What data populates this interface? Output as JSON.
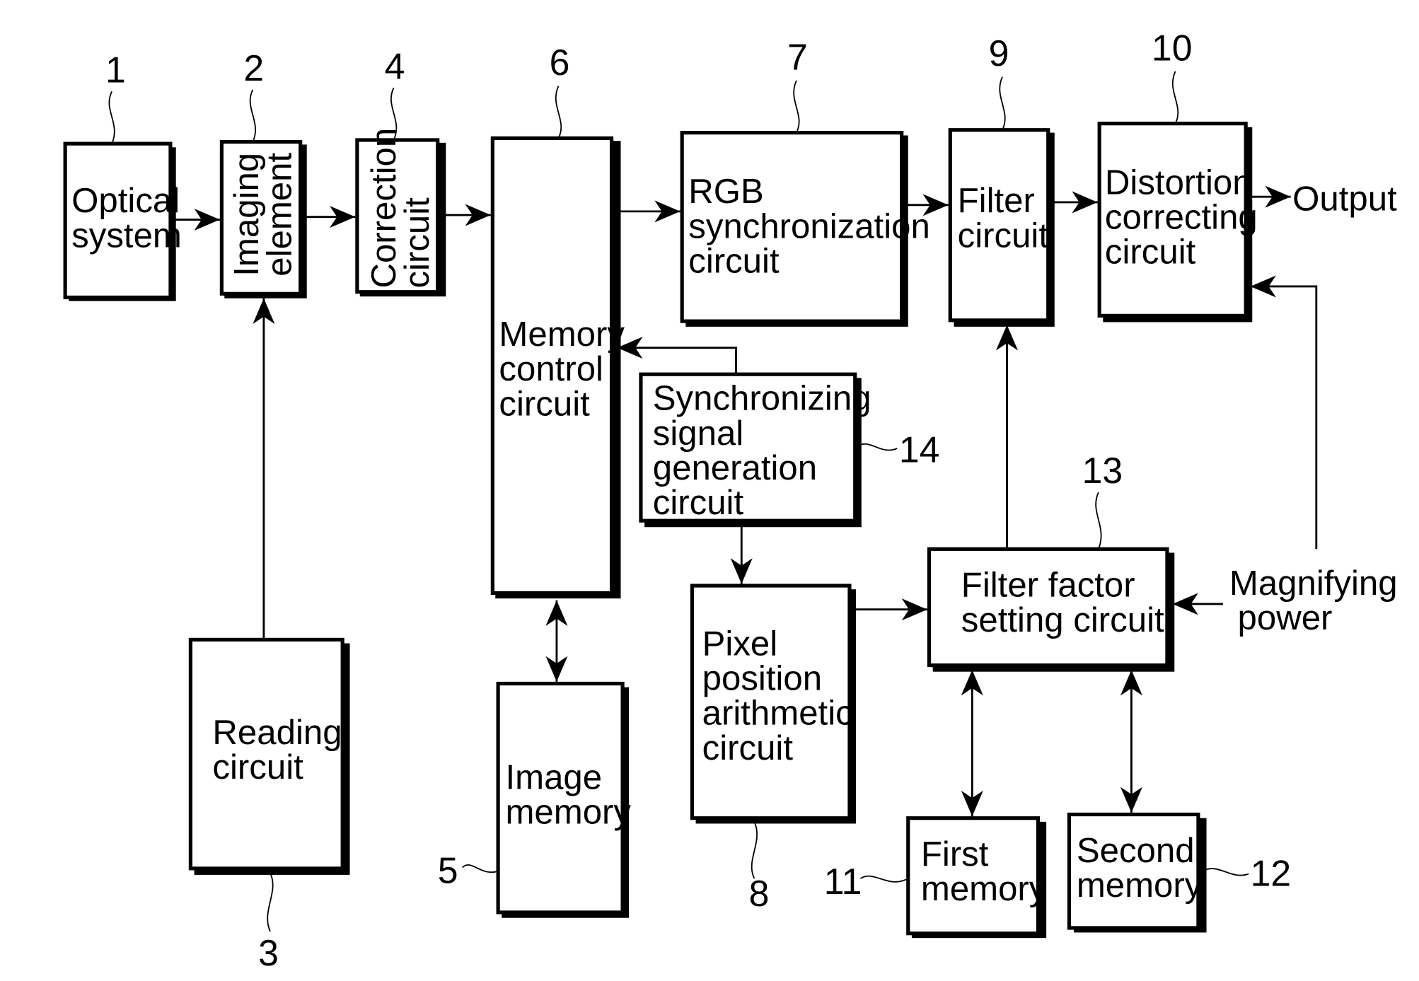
{
  "figure": {
    "blocks": [
      {
        "id": "optical-system",
        "ref": "1",
        "lines": [
          "Optical",
          "system"
        ]
      },
      {
        "id": "imaging-element",
        "ref": "2",
        "lines": [
          "Imaging",
          "element"
        ]
      },
      {
        "id": "reading-circuit",
        "ref": "3",
        "lines": [
          "Reading",
          "circuit"
        ]
      },
      {
        "id": "correction-circuit",
        "ref": "4",
        "lines": [
          "Correction",
          "circuit"
        ]
      },
      {
        "id": "image-memory",
        "ref": "5",
        "lines": [
          "Image",
          "memory"
        ]
      },
      {
        "id": "memory-control-circuit",
        "ref": "6",
        "lines": [
          "Memory",
          "control",
          "circuit"
        ]
      },
      {
        "id": "rgb-synchronization-circuit",
        "ref": "7",
        "lines": [
          "RGB",
          "synchronization",
          "circuit"
        ]
      },
      {
        "id": "pixel-position-arithmetic-circuit",
        "ref": "8",
        "lines": [
          "Pixel",
          "position",
          "arithmetic",
          "circuit"
        ]
      },
      {
        "id": "filter-circuit",
        "ref": "9",
        "lines": [
          "Filter",
          "circuit"
        ]
      },
      {
        "id": "distortion-correcting-circuit",
        "ref": "10",
        "lines": [
          "Distortion",
          "correcting",
          "circuit"
        ]
      },
      {
        "id": "first-memory",
        "ref": "11",
        "lines": [
          "First",
          "memory"
        ]
      },
      {
        "id": "second-memory",
        "ref": "12",
        "lines": [
          "Second",
          "memory"
        ]
      },
      {
        "id": "filter-factor-setting-circuit",
        "ref": "13",
        "lines": [
          "Filter factor",
          "setting circuit"
        ]
      },
      {
        "id": "synchronizing-signal-generation-circuit",
        "ref": "14",
        "lines": [
          "Synchronizing",
          "signal",
          "generation",
          "circuit"
        ]
      }
    ],
    "external_labels": {
      "output": "Output",
      "magnifying_power": [
        "Magnifying",
        "power"
      ]
    }
  }
}
